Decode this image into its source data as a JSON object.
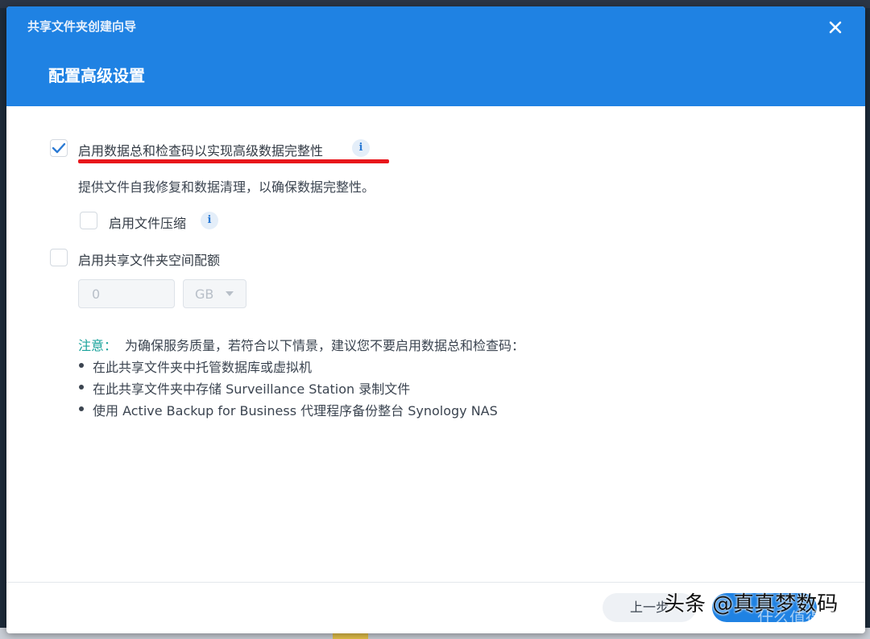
{
  "wizard": {
    "title": "共享文件夹创建向导",
    "step_title": "配置高级设置"
  },
  "options": {
    "checksum": {
      "label": "启用数据总和检查码以实现高级数据完整性",
      "checked": true,
      "description": "提供文件自我修复和数据清理，以确保数据完整性。"
    },
    "compression": {
      "label": "启用文件压缩",
      "checked": false
    },
    "quota": {
      "label": "启用共享文件夹空间配额",
      "checked": false,
      "value": "0",
      "unit": "GB"
    }
  },
  "info_icon_glyph": "i",
  "note": {
    "label": "注意：",
    "text": "为确保服务质量，若符合以下情景，建议您不要启用数据总和检查码：",
    "items": [
      "在此共享文件夹中托管数据库或虚拟机",
      "在此共享文件夹中存储 Surveillance Station 录制文件",
      "使用 Active Backup for Business 代理程序备份整台 Synology NAS"
    ]
  },
  "footer": {
    "prev_label": "上一步"
  },
  "watermark": {
    "text": "头条 @真真梦数码",
    "text2": "什么值得买"
  },
  "colors": {
    "header": "#1f82e3",
    "accent": "#2b7ad4",
    "note": "#1ba39c",
    "underline": "#e8161b"
  }
}
